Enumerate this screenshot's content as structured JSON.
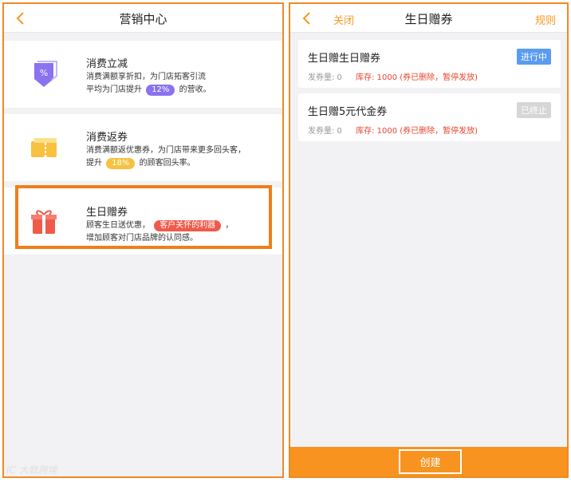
{
  "left": {
    "nav": {
      "title": "营销中心"
    },
    "cards": [
      {
        "title": "消费立减",
        "desc1": "消费满额享折扣，为门店拓客引流",
        "desc2_pre": "平均为门店提升",
        "pill": "12%",
        "desc2_post": "的营收。",
        "icon": "discount-ticket-icon",
        "color": "#8a72f0"
      },
      {
        "title": "消费返券",
        "desc1": "消费满额返优惠券，为门店带来更多回头客，",
        "desc2_pre": "提升",
        "pill": "18%",
        "desc2_post": "的顾客回头率。",
        "icon": "coupon-icon",
        "color": "#f6c240"
      },
      {
        "title": "生日赠券",
        "desc1_pre": "顾客生日送优惠，",
        "pill": "客户关怀的利器",
        "desc1_post": "，",
        "desc2": "增加顾客对门店品牌的认同感。",
        "icon": "gift-icon",
        "color": "#f05a4a"
      }
    ]
  },
  "right": {
    "nav": {
      "close": "关闭",
      "title": "生日赠券",
      "rules": "规则"
    },
    "coupons": [
      {
        "title": "生日赠生日赠券",
        "badge": "进行中",
        "issued": "发券量: 0",
        "stock": "库存: 1000 (券已删除，暂停发放)"
      },
      {
        "title": "生日赠5元代金券",
        "badge": "已终止",
        "issued": "发券量: 0",
        "stock": "库存: 1000 (券已删除，暂停发放)"
      }
    ],
    "create_label": "创建"
  },
  "watermark": "IC 大数跨境",
  "colors": {
    "accent": "#f7931e",
    "active": "#5a9cf0",
    "ended": "#d6d6d6",
    "danger": "#e8452e"
  }
}
